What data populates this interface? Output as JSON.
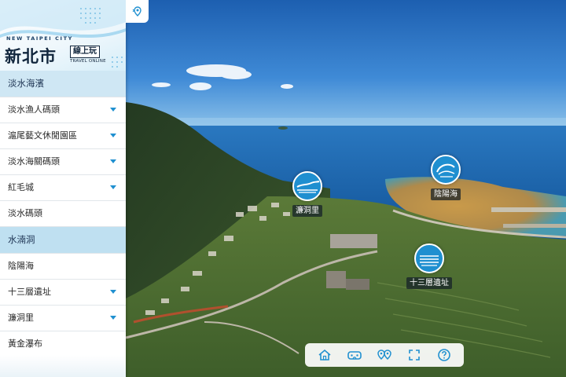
{
  "brand": {
    "city_en": "NEW TAIPEI CITY",
    "city_zh": "新北市",
    "tag_zh": "線上玩",
    "tag_en": "TRAVEL ONLINE"
  },
  "menu": {
    "items": [
      {
        "label": "淡水海濱",
        "type": "group",
        "caret": false
      },
      {
        "label": "淡水漁人碼頭",
        "type": "item",
        "caret": true
      },
      {
        "label": "滬尾藝文休閒園區",
        "type": "item",
        "caret": true
      },
      {
        "label": "淡水海關碼頭",
        "type": "item",
        "caret": true
      },
      {
        "label": "紅毛城",
        "type": "item",
        "caret": true
      },
      {
        "label": "淡水碼頭",
        "type": "item",
        "caret": false
      },
      {
        "label": "水湳洞",
        "type": "group",
        "caret": false
      },
      {
        "label": "陰陽海",
        "type": "item",
        "caret": false
      },
      {
        "label": "十三層遺址",
        "type": "item",
        "caret": true
      },
      {
        "label": "濂洞里",
        "type": "item",
        "caret": true
      },
      {
        "label": "黃金瀑布",
        "type": "item",
        "caret": false
      }
    ]
  },
  "hotspots": [
    {
      "label": "濂洞里"
    },
    {
      "label": "陰陽海"
    },
    {
      "label": "十三層遺址"
    }
  ],
  "toolbar": {
    "buttons": [
      {
        "icon": "home-icon"
      },
      {
        "icon": "vr-goggles-icon"
      },
      {
        "icon": "map-pins-icon"
      },
      {
        "icon": "fullscreen-icon"
      },
      {
        "icon": "help-icon"
      }
    ]
  },
  "colors": {
    "accent": "#2090d0",
    "group_bg": "#cfe7f4",
    "sea": "#1e72b6",
    "sky": "#2b78c7"
  }
}
